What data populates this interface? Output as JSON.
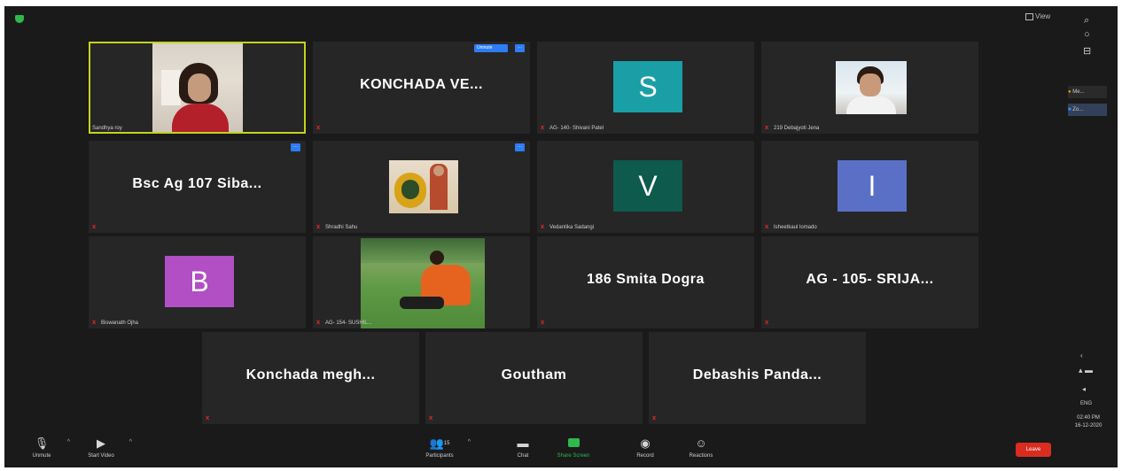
{
  "window": {
    "view_label": "View"
  },
  "tiles": [
    {
      "label": "Sandhya roy",
      "muted": false,
      "active": true
    },
    {
      "name": "KONCHADA  VE...",
      "muted": true,
      "badges": [
        "Unmute",
        "···"
      ]
    },
    {
      "initial": "S",
      "label": "AG- 140- Shivani Patel",
      "avatar_color": "#1a9fa6",
      "muted": true
    },
    {
      "label": "219 Debajyoti Jena",
      "muted": true
    },
    {
      "name": "Bsc Ag 107 Siba...",
      "muted": true,
      "badges": [
        "···"
      ]
    },
    {
      "label": "Shradhi Sahu",
      "muted": true,
      "badges": [
        "···"
      ]
    },
    {
      "initial": "V",
      "label": "Vedantika Sadangi",
      "avatar_color": "#0e5a4c",
      "muted": true
    },
    {
      "initial": "I",
      "label": "Isheetkaul lomado",
      "avatar_color": "#5a6fc6",
      "muted": true
    },
    {
      "initial": "B",
      "label": "Biswanath Ojha",
      "avatar_color": "#b24fc4",
      "muted": true
    },
    {
      "label": "AG- 154- SUSHIL...",
      "muted": true
    },
    {
      "name": "186 Smita Dogra",
      "muted": true
    },
    {
      "name": "AG - 105- SRIJA...",
      "muted": true
    },
    {
      "name": "Konchada  megh...",
      "muted": true
    },
    {
      "name": "Goutham",
      "muted": true
    },
    {
      "name": "Debashis  Panda...",
      "muted": true
    }
  ],
  "toolbar": {
    "unmute": "Unmute",
    "start_video": "Start Video",
    "participants": "Participants",
    "participants_count": "15",
    "chat": "Chat",
    "share_screen": "Share Screen",
    "record": "Record",
    "reactions": "Reactions",
    "leave": "Leave"
  },
  "sidebar": {
    "item1": "Me...",
    "item2": "Zo..."
  },
  "taskbar": {
    "lang": "ENG",
    "time": "02:40 PM",
    "date": "16-12-2020"
  }
}
